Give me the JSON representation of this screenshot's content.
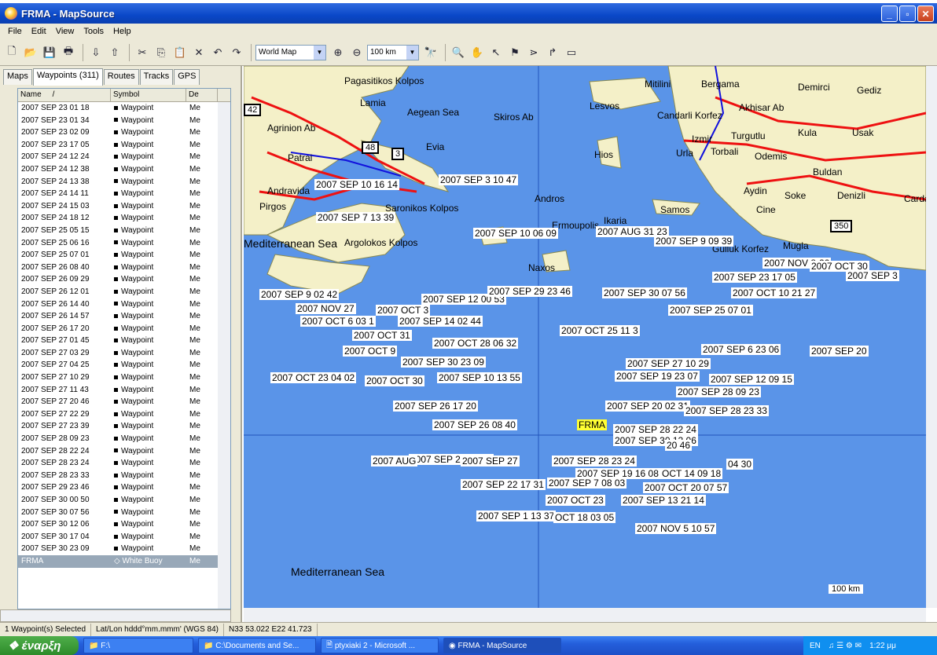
{
  "window": {
    "title": "FRMA - MapSource"
  },
  "menu": [
    "File",
    "Edit",
    "View",
    "Tools",
    "Help"
  ],
  "toolbar": {
    "map_product": "World Map",
    "zoom_scale": "100 km"
  },
  "tabs": [
    "Maps",
    "Waypoints (311)",
    "Routes",
    "Tracks",
    "GPS"
  ],
  "columns": {
    "name": "Name",
    "symbol": "Symbol",
    "desc": "De"
  },
  "waypoints": [
    [
      "2007 SEP 23  01 18",
      "Waypoint",
      "Me"
    ],
    [
      "2007 SEP 23  01 34",
      "Waypoint",
      "Me"
    ],
    [
      "2007 SEP 23  02 09",
      "Waypoint",
      "Me"
    ],
    [
      "2007 SEP 23  17 05",
      "Waypoint",
      "Me"
    ],
    [
      "2007 SEP 24  12 24",
      "Waypoint",
      "Me"
    ],
    [
      "2007 SEP 24  12 38",
      "Waypoint",
      "Me"
    ],
    [
      "2007 SEP 24  13 38",
      "Waypoint",
      "Me"
    ],
    [
      "2007 SEP 24  14 11",
      "Waypoint",
      "Me"
    ],
    [
      "2007 SEP 24  15 03",
      "Waypoint",
      "Me"
    ],
    [
      "2007 SEP 24  18 12",
      "Waypoint",
      "Me"
    ],
    [
      "2007 SEP 25  05 15",
      "Waypoint",
      "Me"
    ],
    [
      "2007 SEP 25  06 16",
      "Waypoint",
      "Me"
    ],
    [
      "2007 SEP 25  07 01",
      "Waypoint",
      "Me"
    ],
    [
      "2007 SEP 26  08 40",
      "Waypoint",
      "Me"
    ],
    [
      "2007 SEP 26  09 29",
      "Waypoint",
      "Me"
    ],
    [
      "2007 SEP 26  12 01",
      "Waypoint",
      "Me"
    ],
    [
      "2007 SEP 26  14 40",
      "Waypoint",
      "Me"
    ],
    [
      "2007 SEP 26  14 57",
      "Waypoint",
      "Me"
    ],
    [
      "2007 SEP 26  17 20",
      "Waypoint",
      "Me"
    ],
    [
      "2007 SEP 27  01 45",
      "Waypoint",
      "Me"
    ],
    [
      "2007 SEP 27  03 29",
      "Waypoint",
      "Me"
    ],
    [
      "2007 SEP 27  04 25",
      "Waypoint",
      "Me"
    ],
    [
      "2007 SEP 27  10 29",
      "Waypoint",
      "Me"
    ],
    [
      "2007 SEP 27  11 43",
      "Waypoint",
      "Me"
    ],
    [
      "2007 SEP 27  20 46",
      "Waypoint",
      "Me"
    ],
    [
      "2007 SEP 27  22 29",
      "Waypoint",
      "Me"
    ],
    [
      "2007 SEP 27  23 39",
      "Waypoint",
      "Me"
    ],
    [
      "2007 SEP 28  09 23",
      "Waypoint",
      "Me"
    ],
    [
      "2007 SEP 28  22 24",
      "Waypoint",
      "Me"
    ],
    [
      "2007 SEP 28  23 24",
      "Waypoint",
      "Me"
    ],
    [
      "2007 SEP 28  23 33",
      "Waypoint",
      "Me"
    ],
    [
      "2007 SEP 29  23 46",
      "Waypoint",
      "Me"
    ],
    [
      "2007 SEP 30  00 50",
      "Waypoint",
      "Me"
    ],
    [
      "2007 SEP 30  07 56",
      "Waypoint",
      "Me"
    ],
    [
      "2007 SEP 30  12 06",
      "Waypoint",
      "Me"
    ],
    [
      "2007 SEP 30  17 04",
      "Waypoint",
      "Me"
    ],
    [
      "2007 SEP 30  23 09",
      "Waypoint",
      "Me"
    ]
  ],
  "selected_row": [
    "FRMA",
    "White Buoy",
    "Me"
  ],
  "map": {
    "places": [
      "Pagasitikos Kolpos",
      "Lamia",
      "Aegean Sea",
      "Skiros Ab",
      "Lesvos",
      "Mitilini",
      "Bergama",
      "Demirci",
      "Gediz",
      "Agrinion Ab",
      "Candarli Korfez",
      "Akhisar Ab",
      "Kula",
      "Usak",
      "Evia",
      "Hios",
      "Urla",
      "Izmir",
      "Turgutlu",
      "Patrai",
      "Torbali",
      "Odemis",
      "Buldan",
      "Andravida",
      "Andros",
      "Aydin",
      "Soke",
      "Denizli",
      "Cardak",
      "Pirgos",
      "Saronikos Kolpos",
      "Samos",
      "Cine",
      "Ikaria",
      "Ermoupolis",
      "Argolokos Kolpos",
      "Mugla",
      "Gulluk Korfez",
      "Naxos",
      "Mediterranean Sea",
      "Mediterranean Sea"
    ],
    "waypoint_labels": [
      "2007 SEP 10   16 14",
      "2007 SEP 3   10 47",
      "2007 SEP 7   13 39",
      "2007 SEP 10   06 09",
      "2007 AUG 31   23",
      "2007 SEP 9   09 39",
      "2007 NOV 8-20",
      "2007 OCT 30",
      "2007 SEP 3",
      "2007 SEP 23   17 05",
      "2007 SEP 9   02 42",
      "2007 SEP 12   00 53",
      "2007 SEP 29   23 46",
      "2007 SEP 30   07 56",
      "2007 OCT 10   21 27",
      "2007 NOV 27",
      "2007 OCT 3",
      "2007 SEP 25   07 01",
      "2007 OCT 6   03 1",
      "2007 SEP 14   02 44",
      "2007 OCT 25   11 3",
      "2007 OCT 31",
      "2007 OCT 28   06 32",
      "2007 OCT 9",
      "2007 SEP 6   23 06",
      "2007 SEP 20",
      "2007 SEP 30   23 09",
      "2007 SEP 27   10 29",
      "2007 OCT 23   04 02",
      "2007 OCT 30",
      "2007 SEP 10   13 55",
      "2007 SEP 19   23 07",
      "2007 SEP 12   09 15",
      "2007 SEP 28   09 23",
      "2007 SEP 26   17 20",
      "2007 SEP 20   02 31",
      "2007 SEP 28   23 33",
      "2007 SEP 26   08 40",
      "2007 SEP 28   22 24",
      "2007 SEP 30   12 06",
      "20 46",
      "2007 SEP 24   18 12",
      "2007 SEP 28   23 24",
      "2007 AUG",
      "2007 SEP 27",
      "2007 SEP 19   16 08",
      "OCT 14   09 18",
      "04 30",
      "2007 SEP 22   17 31",
      "2007 SEP 7   08 03",
      "2007 OCT 20   07 57",
      "2007 OCT 23",
      "2007 SEP 13   21 14",
      "2007 SEP 1   13 37",
      "OCT 18   03 05",
      "2007 NOV 5   10 57",
      "FRMA"
    ],
    "road_numbers": [
      "42",
      "48",
      "3",
      "350"
    ],
    "scale_label": "100 km"
  },
  "status": {
    "selected": "1 Waypoint(s) Selected",
    "format": "Lat/Lon hddd°mm.mmm' (WGS 84)",
    "coords": "N33 53.022 E22 41.723"
  },
  "taskbar": {
    "start": "έναρξη",
    "tasks": [
      "F:\\",
      "C:\\Documents and Se...",
      "ptyxiaki 2 - Microsoft ...",
      "FRMA - MapSource"
    ],
    "lang": "EN",
    "clock": "1:22 μμ"
  }
}
